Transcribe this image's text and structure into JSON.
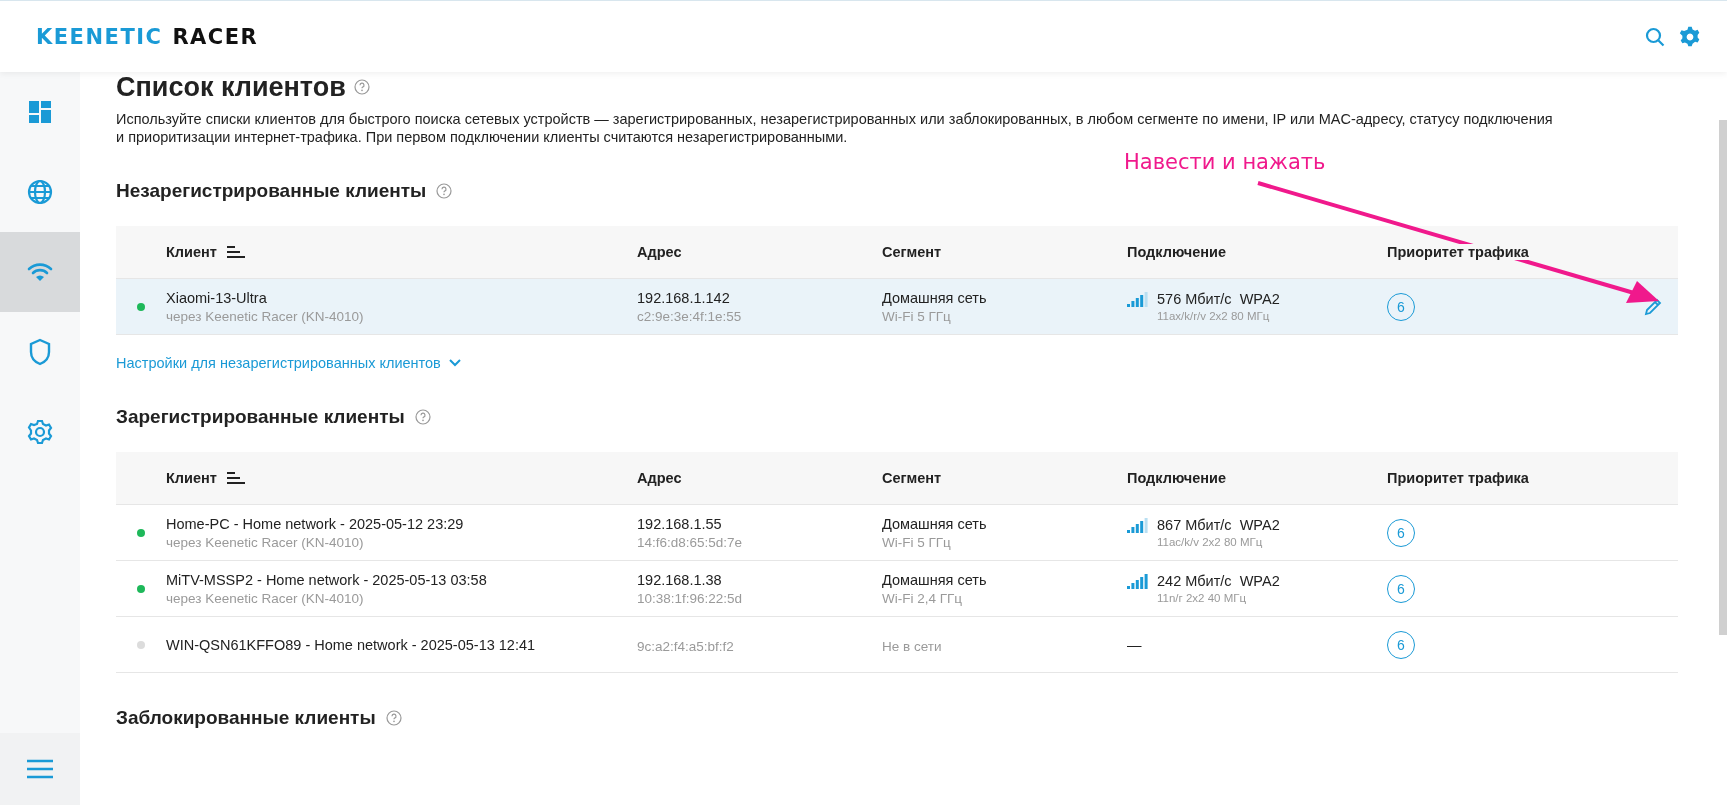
{
  "header": {
    "logo_brand": "KEENETIC",
    "logo_model": "RACER"
  },
  "sidebar": {
    "items": [
      {
        "kind": "dashboard",
        "selected": false
      },
      {
        "kind": "internet",
        "selected": false
      },
      {
        "kind": "wifi",
        "selected": true
      },
      {
        "kind": "security",
        "selected": false
      },
      {
        "kind": "settings",
        "selected": false
      }
    ]
  },
  "page": {
    "title": "Список клиентов",
    "description": "Используйте списки клиентов для быстрого поиска сетевых устройств — зарегистрированных, незарегистрированных или заблокированных, в любом сегменте по имени, IP или MAC-адресу, статусу подключения и приоритизации интернет-трафика. При первом подключении клиенты считаются незарегистрированными."
  },
  "sections": [
    {
      "title": "Незарегистрированные клиенты",
      "columns": [
        "Клиент",
        "Адрес",
        "Сегмент",
        "Подключение",
        "Приоритет трафика"
      ],
      "rows": [
        {
          "online": true,
          "highlighted": true,
          "name": "Xiaomi-13-Ultra",
          "via": "через Keenetic Racer (KN-4010)",
          "ip": "192.168.1.142",
          "mac": "c2:9e:3e:4f:1e:55",
          "segment": "Домашняя сеть",
          "band": "Wi-Fi 5 ГГц",
          "strong_signal": false,
          "speed": "576 Мбит/с",
          "security": "WPA2",
          "mode": "11ax/k/r/v 2x2 80 МГц",
          "priority": "6"
        }
      ],
      "link": "Настройки для незарегистрированных клиентов"
    },
    {
      "title": "Зарегистрированные клиенты",
      "columns": [
        "Клиент",
        "Адрес",
        "Сегмент",
        "Подключение",
        "Приоритет трафика"
      ],
      "rows": [
        {
          "online": true,
          "highlighted": false,
          "name": "Home-PC - Home network - 2025-05-12 23:29",
          "via": "через Keenetic Racer (KN-4010)",
          "ip": "192.168.1.55",
          "mac": "14:f6:d8:65:5d:7e",
          "segment": "Домашняя сеть",
          "band": "Wi-Fi 5 ГГц",
          "strong_signal": false,
          "speed": "867 Мбит/с",
          "security": "WPA2",
          "mode": "11ac/k/v 2x2 80 МГц",
          "priority": "6"
        },
        {
          "online": true,
          "highlighted": false,
          "name": "MiTV-MSSP2 - Home network - 2025-05-13 03:58",
          "via": "через Keenetic Racer (KN-4010)",
          "ip": "192.168.1.38",
          "mac": "10:38:1f:96:22:5d",
          "segment": "Домашняя сеть",
          "band": "Wi-Fi 2,4 ГГц",
          "strong_signal": true,
          "speed": "242 Мбит/с",
          "security": "WPA2",
          "mode": "11n/г 2x2 40 МГц",
          "priority": "6"
        },
        {
          "online": false,
          "highlighted": false,
          "name": "WIN-QSN61KFFO89 - Home network - 2025-05-13 12:41",
          "mac": "9c:a2:f4:a5:bf:f2",
          "segment": "Не в сети",
          "connection": "—",
          "priority": "6"
        }
      ]
    },
    {
      "title": "Заблокированные клиенты"
    }
  ],
  "annotation": {
    "text": "Навести и нажать"
  }
}
